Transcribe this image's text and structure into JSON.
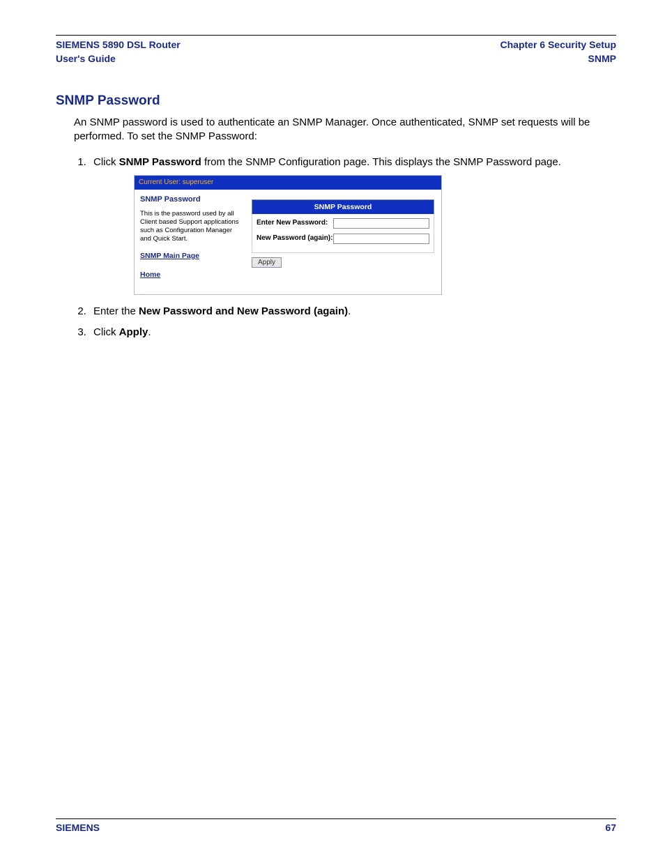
{
  "header": {
    "left_line1": "SIEMENS 5890 DSL Router",
    "left_line2": "User's Guide",
    "right_line1": "Chapter 6  Security Setup",
    "right_line2": "SNMP"
  },
  "section_title": "SNMP Password",
  "intro": "An SNMP password is used to authenticate an SNMP Manager. Once authenticated, SNMP set requests will be performed. To set the SNMP Password:",
  "step1_pre": "Click ",
  "step1_bold": "SNMP Password",
  "step1_post": " from the SNMP Configuration page. This displays the SNMP Password page.",
  "step2_pre": "Enter the ",
  "step2_bold": "New Password and New Password (again)",
  "step2_post": ".",
  "step3_pre": "Click ",
  "step3_bold": "Apply",
  "step3_post": ".",
  "ui": {
    "topbar": "Current User: superuser",
    "side_title": "SNMP Password",
    "side_desc": "This is the password used by all Client based Support applications such as Configuration Manager and Quick Start.",
    "link_main": "SNMP Main Page",
    "link_home": "Home",
    "panel_title": "SNMP Password",
    "label_new": "Enter New Password:",
    "label_again": "New Password (again):",
    "apply": "Apply"
  },
  "footer": {
    "brand": "SIEMENS",
    "page": "67"
  }
}
